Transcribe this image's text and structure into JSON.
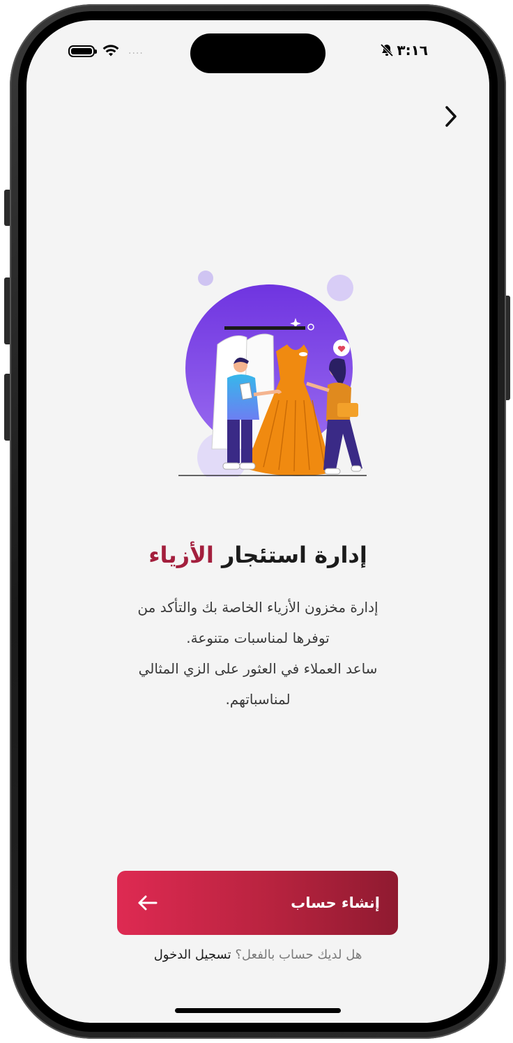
{
  "status_bar": {
    "time": "٣:١٦",
    "signal_dots": "....",
    "icons": [
      "battery-icon",
      "wifi-icon",
      "bell-slash-icon"
    ]
  },
  "nav": {
    "back_icon": "chevron-right-icon"
  },
  "onboarding": {
    "title_main": "إدارة استئجار",
    "title_accent": "الأزياء",
    "description_lines": [
      "إدارة مخزون الأزياء الخاصة بك والتأكد من",
      "توفرها لمناسبات متنوعة.",
      "ساعد العملاء في العثور على الزي المثالي",
      "لمناسباتهم."
    ]
  },
  "actions": {
    "create_account_label": "إنشاء حساب",
    "arrow_icon": "arrow-left-icon",
    "login_question": "هل لديك حساب بالفعل؟",
    "login_link": "تسجيل الدخول"
  },
  "colors": {
    "accent": "#a31f3d",
    "button_start": "#de2a52",
    "button_end": "#8f1a30",
    "illustration_purple": "#7b3fe4",
    "dress_orange": "#f08a10"
  }
}
